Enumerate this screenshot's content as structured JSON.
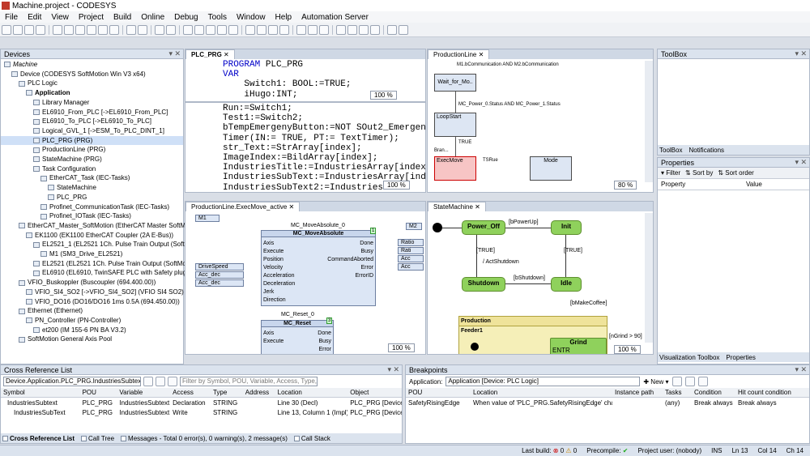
{
  "window": {
    "title": "Machine.project - CODESYS"
  },
  "menu": [
    "File",
    "Edit",
    "View",
    "Project",
    "Build",
    "Online",
    "Debug",
    "Tools",
    "Window",
    "Help",
    "Automation Server"
  ],
  "devices": {
    "title": "Devices",
    "tree": [
      {
        "label": "Machine",
        "indent": 0,
        "italic": true
      },
      {
        "label": "Device (CODESYS SoftMotion Win V3 x64)",
        "indent": 1
      },
      {
        "label": "PLC Logic",
        "indent": 2
      },
      {
        "label": "Application",
        "indent": 3,
        "bold": true
      },
      {
        "label": "Library Manager",
        "indent": 4
      },
      {
        "label": "EL6910_From_PLC [->EL6910_From_PLC]",
        "indent": 4
      },
      {
        "label": "EL6910_To_PLC [->EL6910_To_PLC]",
        "indent": 4
      },
      {
        "label": "Logical_GVL_1 [->ESM_To_PLC_DINT_1]",
        "indent": 4
      },
      {
        "label": "PLC_PRG (PRG)",
        "indent": 4,
        "selected": true
      },
      {
        "label": "ProductionLine (PRG)",
        "indent": 4
      },
      {
        "label": "StateMachine (PRG)",
        "indent": 4
      },
      {
        "label": "Task Configuration",
        "indent": 4
      },
      {
        "label": "EtherCAT_Task (IEC-Tasks)",
        "indent": 5
      },
      {
        "label": "StateMachine",
        "indent": 6
      },
      {
        "label": "PLC_PRG",
        "indent": 6
      },
      {
        "label": "Profinet_CommunicationTask (IEC-Tasks)",
        "indent": 5
      },
      {
        "label": "Profinet_IOTask (IEC-Tasks)",
        "indent": 5
      },
      {
        "label": "EtherCAT_Master_SoftMotion (EtherCAT Master SoftMotion)",
        "indent": 2
      },
      {
        "label": "EK1100 (EK1100 EtherCAT Coupler (2A E-Bus))",
        "indent": 3
      },
      {
        "label": "EL2521_1 (EL2521 1Ch. Pulse Train Output (SoftMotion))",
        "indent": 4
      },
      {
        "label": "M1 (SM3_Drive_EL2521)",
        "indent": 5
      },
      {
        "label": "EL2521 (EL2521 1Ch. Pulse Train Output (SoftMotion))",
        "indent": 4
      },
      {
        "label": "EL6910 (EL6910, TwinSAFE PLC with Safety plug-in)",
        "indent": 4
      },
      {
        "label": "VFIO_Buskoppler (Buscoupler (694.400.00))",
        "indent": 2
      },
      {
        "label": "VFIO_SI4_SO2 [->VFIO_SI4_SO2] (VFIO SI4 SO2)",
        "indent": 3
      },
      {
        "label": "VFIO_DO16 (DO16/DO16 1ms 0.5A (694.450.00))",
        "indent": 3
      },
      {
        "label": "Ethernet (Ethernet)",
        "indent": 2
      },
      {
        "label": "PN_Controller (PN-Controller)",
        "indent": 3
      },
      {
        "label": "et200 (IM 155-6 PN BA V3.2)",
        "indent": 4
      },
      {
        "label": "SoftMotion General Axis Pool",
        "indent": 2
      }
    ]
  },
  "plc_prg": {
    "tab": "PLC_PRG",
    "decl": [
      {
        "kw": "PROGRAM",
        "rest": " PLC_PRG"
      },
      {
        "kw": "VAR",
        "rest": ""
      },
      {
        "kw": "",
        "rest": "    Switch1: BOOL:=TRUE;"
      },
      {
        "kw": "",
        "rest": "    iHugo:INT;"
      }
    ],
    "zoom1": "100 %",
    "body": [
      "Run:=Switch1;",
      "Test1:=Switch2;",
      "bTempEmergenyButton:=NOT SOut2_Emergen",
      "Timer(IN:= TRUE, PT:= TextTimer);",
      "str_Text:=StrArray[index];",
      "ImageIndex:=BildArray[index];",
      "IndustriesTitle:=IndustriesArray[index",
      "IndustriesSubText:=IndustriesArray[ind",
      "IndustriesSubText2:=IndustriesA"
    ],
    "zoom2": "100 %"
  },
  "production_line": {
    "tab": "ProductionLine",
    "top_text": "M1.bCommunication AND M2.bCommunication",
    "steps": [
      "Wait_for_Mo..",
      "LoopStart",
      "ExecMove",
      "Mode"
    ],
    "trans": [
      "MC_Power_0.Status AND MC_Power_1.Status",
      "TRUE"
    ],
    "branch": "Bran...",
    "tsrue": "TSRue",
    "zoom": "80 %"
  },
  "exec_move": {
    "tab": "ProductionLine.ExecMove_active",
    "m1": "M1",
    "m2": "M2",
    "fb1": {
      "instance": "MC_MoveAbsolute_0",
      "type": "MC_MoveAbsolute",
      "num": "1",
      "inputs": [
        "Axis",
        "Execute",
        "Position",
        "Velocity",
        "Acceleration",
        "Deceleration",
        "Jerk",
        "Direction"
      ],
      "outputs": [
        "Done",
        "Busy",
        "CommandAborted",
        "Error",
        "ErrorID"
      ]
    },
    "in_vars": [
      "DriveSpeed",
      "Acc_dec",
      "Acc_dec"
    ],
    "out_vars": [
      "Ratio",
      "Rati",
      "Acc",
      "Acc"
    ],
    "fb2": {
      "instance": "MC_Reset_0",
      "type": "MC_Reset",
      "num": "3",
      "inputs": [
        "Axis",
        "Execute"
      ],
      "outputs": [
        "Done",
        "Busy",
        "Error"
      ]
    },
    "zoom": "100 %"
  },
  "state_machine": {
    "tab": "StateMachine",
    "states": [
      "Power_Off",
      "Init",
      "Shutdown",
      "Idle"
    ],
    "transitions": [
      "[bPowerUp]",
      "[TRUE]",
      "[TRUE]",
      "/ ActShutdown",
      "[bShutdown]",
      "[bMakeCoffee]",
      "[nGrind > 90]"
    ],
    "composite": "Production",
    "sub": "Feeder1",
    "grind": "Grind",
    "entry": "ENTR",
    "zoom": "100 %"
  },
  "toolbox": {
    "title": "ToolBox",
    "tabs": [
      "ToolBox",
      "Notifications"
    ]
  },
  "properties": {
    "title": "Properties",
    "filter": "Filter",
    "sort_by": "Sort by",
    "sort_order": "Sort order",
    "cols": [
      "Property",
      "Value"
    ],
    "tabs": [
      "Visualization Toolbox",
      "Properties"
    ]
  },
  "cross_ref": {
    "title": "Cross Reference List",
    "path": "Device.Application.PLC_PRG.IndustriesSubtext",
    "filter_placeholder": "Filter by Symbol, POU, Variable, Access, Type, Address, Location, Object",
    "cols": [
      "Symbol",
      "POU",
      "Variable",
      "Access",
      "Type",
      "Address",
      "Location",
      "Object"
    ],
    "rows": [
      [
        "IndustriesSubtext",
        "PLC_PRG",
        "IndustriesSubtext",
        "Declaration",
        "STRING",
        "",
        "Line 30 (Decl)",
        "PLC_PRG [Device: PL"
      ],
      [
        "IndustriesSubText",
        "PLC_PRG",
        "IndustriesSubtext",
        "Write",
        "STRING",
        "",
        "Line 13, Column 1 (Impl)",
        "PLC_PRG [Device: PL"
      ]
    ],
    "tabs": [
      "Cross Reference List",
      "Call Tree",
      "Messages - Total 0 error(s), 0 warning(s), 2 message(s)",
      "Call Stack"
    ]
  },
  "breakpoints": {
    "title": "Breakpoints",
    "app_label": "Application:",
    "app": "Application [Device: PLC Logic]",
    "new": "New",
    "cols": [
      "POU",
      "Location",
      "Instance path",
      "Tasks",
      "Condition",
      "Hit count condition"
    ],
    "rows": [
      [
        "SafetyRisingEdge",
        "When value of 'PLC_PRG.SafetyRisingEdge' changes",
        "",
        "(any)",
        "Break always",
        "Break always"
      ]
    ]
  },
  "status": {
    "last_build": "Last build:",
    "err": "0",
    "warn": "0",
    "precompile": "Precompile:",
    "user": "Project user: (nobody)",
    "ins": "INS",
    "ln": "Ln 13",
    "col": "Col 14",
    "ch": "Ch 14"
  }
}
